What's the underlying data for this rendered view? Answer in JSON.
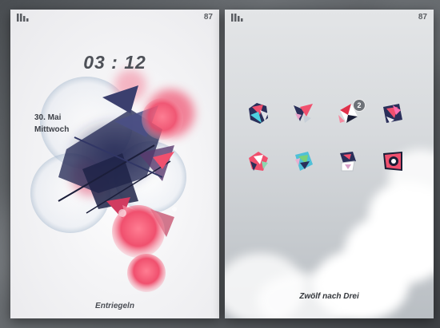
{
  "lock_screen": {
    "status": {
      "signal_icon": "signal-bars-icon",
      "battery": "87"
    },
    "clock": "03 : 12",
    "date_line1": "30. Mai",
    "date_line2": "Mittwoch",
    "unlock_label": "Entriegeln"
  },
  "home_screen": {
    "status": {
      "signal_icon": "signal-bars-icon",
      "battery": "87"
    },
    "apps": [
      {
        "icon": "abstract-app-icon-1",
        "badge": ""
      },
      {
        "icon": "abstract-app-icon-2",
        "badge": ""
      },
      {
        "icon": "abstract-app-icon-3",
        "badge": "2"
      },
      {
        "icon": "abstract-app-icon-4",
        "badge": ""
      },
      {
        "icon": "abstract-app-icon-5",
        "badge": ""
      },
      {
        "icon": "abstract-app-icon-6",
        "badge": ""
      },
      {
        "icon": "abstract-app-icon-7",
        "badge": ""
      },
      {
        "icon": "abstract-app-icon-8",
        "badge": ""
      }
    ],
    "caption": "Zwölf nach Drei"
  },
  "colors": {
    "accent_pink": "#f0506e",
    "accent_navy": "#2a2f5a",
    "text_dark": "#4d5057"
  }
}
